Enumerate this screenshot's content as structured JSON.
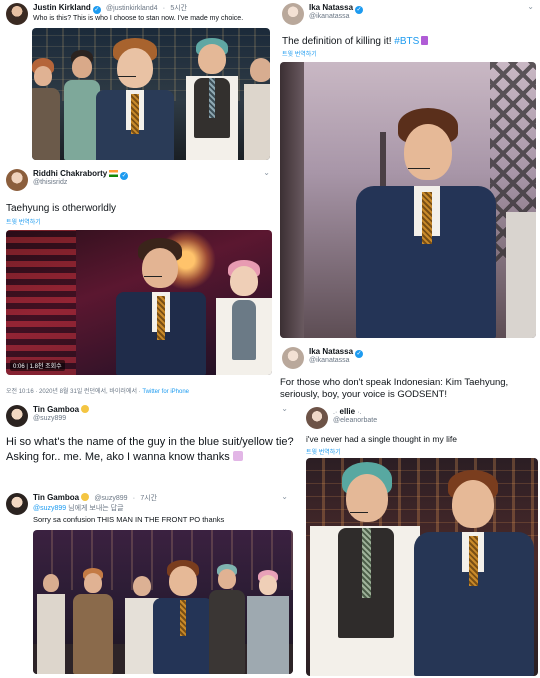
{
  "tweets": [
    {
      "name": "Justin Kirkland",
      "handle": "@justinkirkland4",
      "time": "5시간",
      "text": "Who is this? This is who I choose to stan now. I've made my choice."
    },
    {
      "name": "Riddhi Chakraborty",
      "handle": "@thisisridz",
      "text": "Taehyung is otherworldly",
      "translate": "트윗 번역하기",
      "video_stats": "0:06 | 1.8천 조회수",
      "meta": "오전 10:16 · 2020년 8월 31일 런던에서, 바이러에서 ·",
      "client": "Twitter for iPhone"
    },
    {
      "name": "Ika Natassa",
      "handle": "@ikanatassa",
      "text": "The definition of killing it!",
      "hashtag": "#BTS",
      "translate": "트윗 번역하기"
    },
    {
      "name": "Ika Natassa",
      "handle": "@ikanatassa",
      "text": "For those who don't speak Indonesian: Kim Taehyung, seriously, boy, your voice is GODSENT!"
    },
    {
      "name": "Tin Gamboa",
      "handle": "@suzy899",
      "text": "Hi so what's the name of the guy in the blue suit/yellow tie? Asking for.. me. Me, ako I wanna know thanks"
    },
    {
      "name": "Tin Gamboa",
      "handle": "@suzy899",
      "time": "7시간",
      "reply_to": "@suzy899",
      "reply_suffix": "님에게 보내는 답글",
      "text": "Sorry sa confusion THIS MAN IN THE FRONT PO thanks"
    },
    {
      "name": "ellie",
      "handle": "@eleanorbate",
      "text": "i've never had a single thought in my life",
      "translate": "트윗 번역하기"
    }
  ],
  "colors": {
    "verified": "#1d9bf0",
    "link": "#1d9bf0",
    "muted": "#6b7785",
    "text": "#0f1419",
    "hashtag_heart": "#b05cd6"
  },
  "icons": {
    "verified": "verified-badge-icon",
    "caret": "chevron-down-icon"
  }
}
